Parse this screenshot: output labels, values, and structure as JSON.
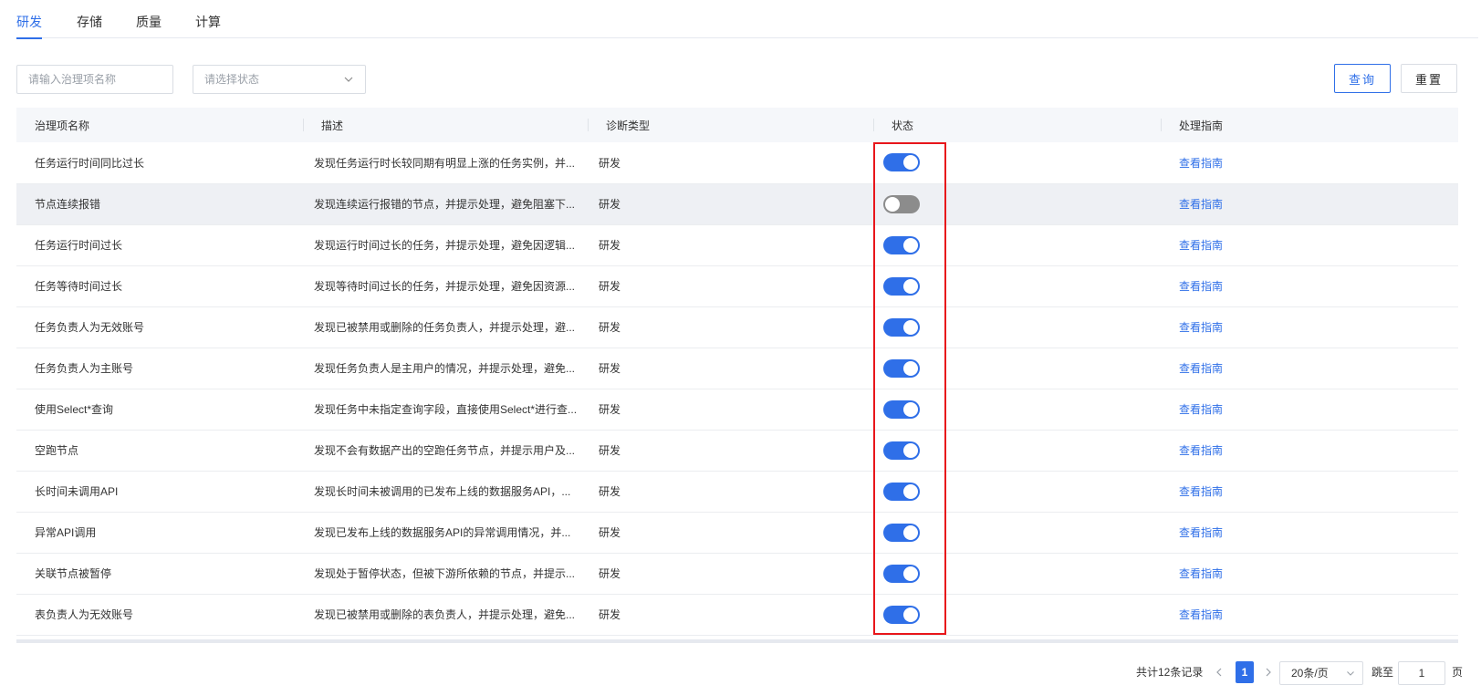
{
  "tabs": [
    {
      "label": "研发",
      "active": true
    },
    {
      "label": "存储",
      "active": false
    },
    {
      "label": "质量",
      "active": false
    },
    {
      "label": "计算",
      "active": false
    }
  ],
  "filters": {
    "name_placeholder": "请输入治理项名称",
    "status_placeholder": "请选择状态",
    "query_label": "查询",
    "reset_label": "重置"
  },
  "table": {
    "headers": [
      "治理项名称",
      "描述",
      "诊断类型",
      "状态",
      "处理指南"
    ],
    "rows": [
      {
        "name": "任务运行时间同比过长",
        "desc": "发现任务运行时长较同期有明显上涨的任务实例，并...",
        "type": "研发",
        "enabled": true,
        "guide": "查看指南"
      },
      {
        "name": "节点连续报错",
        "desc": "发现连续运行报错的节点，并提示处理，避免阻塞下...",
        "type": "研发",
        "enabled": false,
        "guide": "查看指南"
      },
      {
        "name": "任务运行时间过长",
        "desc": "发现运行时间过长的任务，并提示处理，避免因逻辑...",
        "type": "研发",
        "enabled": true,
        "guide": "查看指南"
      },
      {
        "name": "任务等待时间过长",
        "desc": "发现等待时间过长的任务，并提示处理，避免因资源...",
        "type": "研发",
        "enabled": true,
        "guide": "查看指南"
      },
      {
        "name": "任务负责人为无效账号",
        "desc": "发现已被禁用或删除的任务负责人，并提示处理，避...",
        "type": "研发",
        "enabled": true,
        "guide": "查看指南"
      },
      {
        "name": "任务负责人为主账号",
        "desc": "发现任务负责人是主用户的情况，并提示处理，避免...",
        "type": "研发",
        "enabled": true,
        "guide": "查看指南"
      },
      {
        "name": "使用Select*查询",
        "desc": "发现任务中未指定查询字段，直接使用Select*进行查...",
        "type": "研发",
        "enabled": true,
        "guide": "查看指南"
      },
      {
        "name": "空跑节点",
        "desc": "发现不会有数据产出的空跑任务节点，并提示用户及...",
        "type": "研发",
        "enabled": true,
        "guide": "查看指南"
      },
      {
        "name": "长时间未调用API",
        "desc": "发现长时间未被调用的已发布上线的数据服务API，...",
        "type": "研发",
        "enabled": true,
        "guide": "查看指南"
      },
      {
        "name": "异常API调用",
        "desc": "发现已发布上线的数据服务API的异常调用情况，并...",
        "type": "研发",
        "enabled": true,
        "guide": "查看指南"
      },
      {
        "name": "关联节点被暂停",
        "desc": "发现处于暂停状态，但被下游所依赖的节点，并提示...",
        "type": "研发",
        "enabled": true,
        "guide": "查看指南"
      },
      {
        "name": "表负责人为无效账号",
        "desc": "发现已被禁用或删除的表负责人，并提示处理，避免...",
        "type": "研发",
        "enabled": true,
        "guide": "查看指南"
      }
    ]
  },
  "pagination": {
    "total_text": "共计12条记录",
    "current_page": "1",
    "page_size": "20条/页",
    "jump_label": "跳至",
    "jump_value": "1",
    "page_suffix": "页"
  },
  "colors": {
    "accent": "#2f6fe8",
    "switch_off": "#8c8c8c",
    "highlight": "#e8161b"
  },
  "icons": {
    "select_chevron": "chevron-down-icon",
    "prev": "chevron-left-icon",
    "next": "chevron-right-icon"
  }
}
